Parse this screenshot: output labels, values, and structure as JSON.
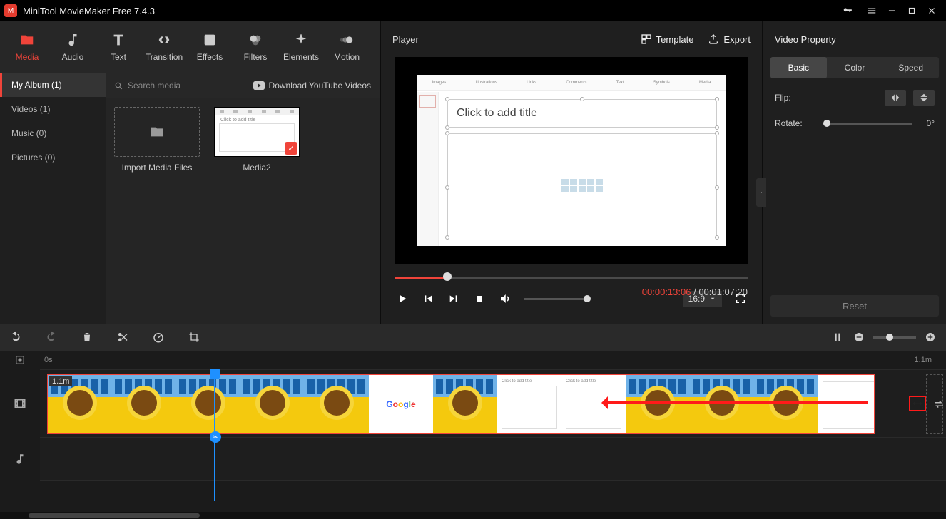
{
  "app": {
    "title": "MiniTool MovieMaker Free 7.4.3"
  },
  "toolbar": {
    "media": "Media",
    "audio": "Audio",
    "text": "Text",
    "transition": "Transition",
    "effects": "Effects",
    "filters": "Filters",
    "elements": "Elements",
    "motion": "Motion"
  },
  "sidebar": {
    "items": [
      {
        "label": "My Album (1)"
      },
      {
        "label": "Videos (1)"
      },
      {
        "label": "Music (0)"
      },
      {
        "label": "Pictures (0)"
      }
    ]
  },
  "media": {
    "search_placeholder": "Search media",
    "download_yt": "Download YouTube Videos",
    "import_label": "Import Media Files",
    "clip_name": "Media2"
  },
  "player": {
    "title": "Player",
    "template": "Template",
    "export": "Export",
    "slide_title": "Click to add title",
    "ribbon": [
      "Images",
      "Illustrations",
      "Links",
      "Comments",
      "Text",
      "Symbols",
      "Media"
    ],
    "time_current": "00:00:13:06",
    "time_total": "00:01:07:20",
    "aspect": "16:9"
  },
  "property": {
    "title": "Video Property",
    "tabs": {
      "basic": "Basic",
      "color": "Color",
      "speed": "Speed"
    },
    "flip": "Flip:",
    "rotate": "Rotate:",
    "rotate_val": "0°",
    "reset": "Reset"
  },
  "timeline": {
    "start": "0s",
    "end": "1.1m",
    "clip_duration": "1.1m",
    "doc_text": "Click to add title"
  }
}
